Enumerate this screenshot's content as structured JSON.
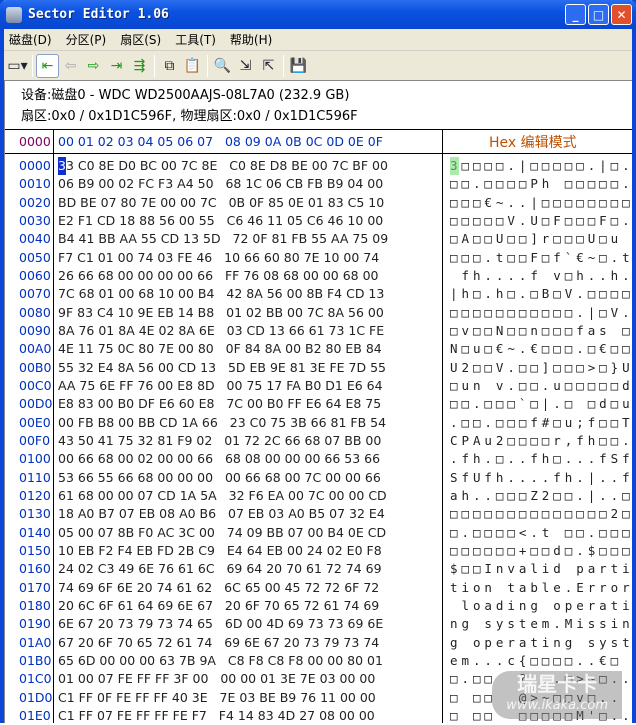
{
  "window": {
    "title": "Sector Editor 1.06",
    "minimize": "_",
    "maximize": "□",
    "close": "✕"
  },
  "menu": [
    "磁盘(D)",
    "分区(P)",
    "扇区(S)",
    "工具(T)",
    "帮助(H)"
  ],
  "toolbar": [
    {
      "icon": "drive-icon",
      "glyph": "▭▾",
      "cls": "dark"
    },
    {
      "sep": true
    },
    {
      "icon": "first-sector-icon",
      "glyph": "⇤",
      "cls": "green sel"
    },
    {
      "icon": "previous-sector-icon",
      "glyph": "⇦",
      "cls": "grey"
    },
    {
      "icon": "next-sector-icon",
      "glyph": "⇨",
      "cls": "green"
    },
    {
      "icon": "last-sector-icon",
      "glyph": "⇥",
      "cls": "green"
    },
    {
      "icon": "goto-sector-icon",
      "glyph": "⇶",
      "cls": "green"
    },
    {
      "sep": true
    },
    {
      "icon": "copy-icon",
      "glyph": "⧉",
      "cls": "dark"
    },
    {
      "icon": "paste-icon",
      "glyph": "📋",
      "cls": "grey"
    },
    {
      "sep": true
    },
    {
      "icon": "find-icon",
      "glyph": "🔍",
      "cls": "dark"
    },
    {
      "icon": "export-icon",
      "glyph": "⇲",
      "cls": "dark"
    },
    {
      "icon": "import-icon",
      "glyph": "⇱",
      "cls": "dark"
    },
    {
      "sep": true
    },
    {
      "icon": "save-icon",
      "glyph": "💾",
      "cls": "grey"
    }
  ],
  "info": {
    "device_label": "设备:",
    "device_value": "磁盘0 - WDC WD2500AAJS-08L7A0 (232.9 GB)",
    "sector_label": "扇区:",
    "sector_value": "0x0 / 0x1D1C596F,",
    "physical_label": "物理扇区:",
    "physical_value": "0x0 / 0x1D1C596F"
  },
  "header": {
    "offset": "0000",
    "columns": "00 01 02 03 04 05 06 07   08 09 0A 0B 0C 0D 0E 0F",
    "mode": "Hex 编辑模式"
  },
  "rows": [
    {
      "off": "0000",
      "hex": "33 C0 8E D0 BC 00 7C 8E   C0 8E D8 BE 00 7C BF 00",
      "txt": "3□□□□.|□□□□□.|□."
    },
    {
      "off": "0010",
      "hex": "06 B9 00 02 FC F3 A4 50   68 1C 06 CB FB B9 04 00",
      "txt": "□□.□□□□Ph □□□□□."
    },
    {
      "off": "0020",
      "hex": "BD BE 07 80 7E 00 00 7C   0B 0F 85 0E 01 83 C5 10",
      "txt": "□□□€~..|□□□□□□□□"
    },
    {
      "off": "0030",
      "hex": "E2 F1 CD 18 88 56 00 55   C6 46 11 05 C6 46 10 00",
      "txt": "□□□□□V.U□F□□□F□."
    },
    {
      "off": "0040",
      "hex": "B4 41 BB AA 55 CD 13 5D   72 0F 81 FB 55 AA 75 09",
      "txt": "□A□□U□□]r□□□U□u "
    },
    {
      "off": "0050",
      "hex": "F7 C1 01 00 74 03 FE 46   10 66 60 80 7E 10 00 74",
      "txt": "□□□.t□□F□f`€~□.t"
    },
    {
      "off": "0060",
      "hex": "26 66 68 00 00 00 00 66   FF 76 08 68 00 00 68 00",
      "txt": " fh....f v□h..h."
    },
    {
      "off": "0070",
      "hex": "7C 68 01 00 68 10 00 B4   42 8A 56 00 8B F4 CD 13",
      "txt": "|h□.h□.□B□V.□□□□"
    },
    {
      "off": "0080",
      "hex": "9F 83 C4 10 9E EB 14 B8   01 02 BB 00 7C 8A 56 00",
      "txt": "□□□□□□□□□□□.|□V."
    },
    {
      "off": "0090",
      "hex": "8A 76 01 8A 4E 02 8A 6E   03 CD 13 66 61 73 1C FE",
      "txt": "□v□□N□□n□□□fas □"
    },
    {
      "off": "00A0",
      "hex": "4E 11 75 0C 80 7E 00 80   0F 84 8A 00 B2 80 EB 84",
      "txt": "N□u□€~.€□□□.□€□□"
    },
    {
      "off": "00B0",
      "hex": "55 32 E4 8A 56 00 CD 13   5D EB 9E 81 3E FE 7D 55",
      "txt": "U2□□V.□□]□□□>□}U"
    },
    {
      "off": "00C0",
      "hex": "AA 75 6E FF 76 00 E8 8D   00 75 17 FA B0 D1 E6 64",
      "txt": "□un v.□□.u□□□□□d"
    },
    {
      "off": "00D0",
      "hex": "E8 83 00 B0 DF E6 60 E8   7C 00 B0 FF E6 64 E8 75",
      "txt": "□□.□□□`□|.□ □d□u"
    },
    {
      "off": "00E0",
      "hex": "00 FB B8 00 BB CD 1A 66   23 C0 75 3B 66 81 FB 54",
      "txt": ".□□.□□□f#□u;f□□T"
    },
    {
      "off": "00F0",
      "hex": "43 50 41 75 32 81 F9 02   01 72 2C 66 68 07 BB 00",
      "txt": "CPAu2□□□□r,fh□□."
    },
    {
      "off": "0100",
      "hex": "00 66 68 00 02 00 00 66   68 08 00 00 00 66 53 66",
      "txt": ".fh.□..fh□...fSf"
    },
    {
      "off": "0110",
      "hex": "53 66 55 66 68 00 00 00   00 66 68 00 7C 00 00 66",
      "txt": "SfUfh....fh.|..f"
    },
    {
      "off": "0120",
      "hex": "61 68 00 00 07 CD 1A 5A   32 F6 EA 00 7C 00 00 CD",
      "txt": "ah..□□□Z2□□.|..□"
    },
    {
      "off": "0130",
      "hex": "18 A0 B7 07 EB 08 A0 B6   07 EB 03 A0 B5 07 32 E4",
      "txt": "□□□□□□□□□□□□□□2□"
    },
    {
      "off": "0140",
      "hex": "05 00 07 8B F0 AC 3C 00   74 09 BB 07 00 B4 0E CD",
      "txt": "□.□□□□<.t □□.□□□"
    },
    {
      "off": "0150",
      "hex": "10 EB F2 F4 EB FD 2B C9   E4 64 EB 00 24 02 E0 F8",
      "txt": "□□□□□□+□□d□.$□□□"
    },
    {
      "off": "0160",
      "hex": "24 02 C3 49 6E 76 61 6C   69 64 20 70 61 72 74 69",
      "txt": "$□□Invalid parti"
    },
    {
      "off": "0170",
      "hex": "74 69 6F 6E 20 74 61 62   6C 65 00 45 72 72 6F 72",
      "txt": "tion table.Error"
    },
    {
      "off": "0180",
      "hex": "20 6C 6F 61 64 69 6E 67   20 6F 70 65 72 61 74 69",
      "txt": " loading operati"
    },
    {
      "off": "0190",
      "hex": "6E 67 20 73 79 73 74 65   6D 00 4D 69 73 73 69 6E",
      "txt": "ng system.Missin"
    },
    {
      "off": "01A0",
      "hex": "67 20 6F 70 65 72 61 74   69 6E 67 20 73 79 73 74",
      "txt": "g operating syst"
    },
    {
      "off": "01B0",
      "hex": "65 6D 00 00 00 63 7B 9A   C8 F8 C8 F8 00 00 80 01",
      "txt": "em...c{□□□□..€□"
    },
    {
      "off": "01C0",
      "hex": "01 00 07 FE FF FF 3F 00   00 00 01 3E 7E 03 00 00",
      "txt": "□.□□  ?...□>~□.."
    },
    {
      "off": "01D0",
      "hex": "C1 FF 0F FE FF FF 40 3E   7E 03 BE B9 76 11 00 00",
      "txt": "□ □□  @>~□□v□.."
    },
    {
      "off": "01E0",
      "hex": "C1 FF 07 FE FF FF FE F7   F4 14 83 4D 27 08 00 00",
      "txt": "□ □□  □□□□□M'□.."
    }
  ],
  "watermark": {
    "text": "瑞星卡卡",
    "url": "www.ikaka.com"
  }
}
